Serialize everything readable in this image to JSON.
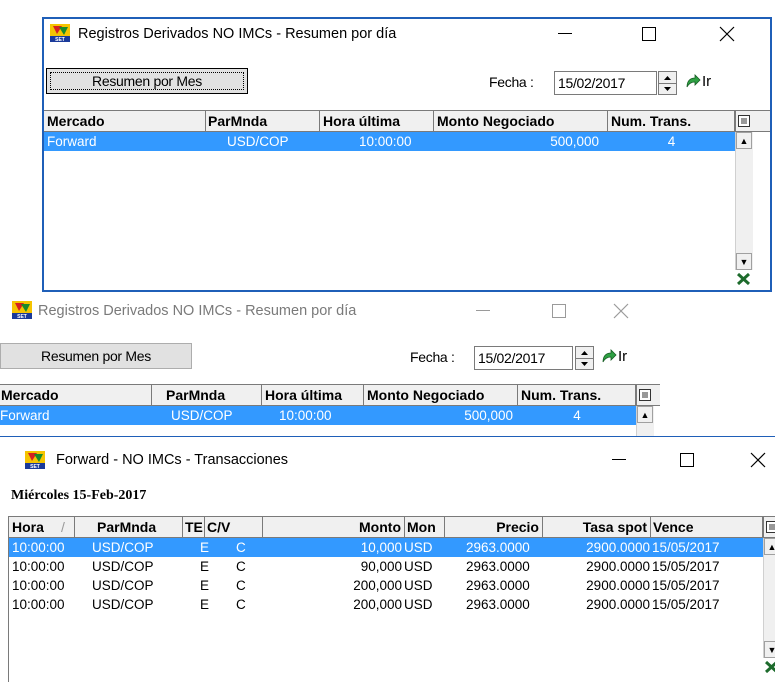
{
  "window1": {
    "title": "Registros Derivados NO IMCs - Resumen por día",
    "minimize": "—",
    "maximize": "☐",
    "close": "✕",
    "button_label": "Resumen por Mes",
    "fecha_label": "Fecha :",
    "fecha_value": "15/02/2017",
    "ir_label": "Ir",
    "columns": [
      "Mercado",
      "ParMnda",
      "Hora última",
      "Monto Negociado",
      "Num. Trans."
    ],
    "rows": [
      [
        "Forward",
        "USD/COP",
        "10:00:00",
        "500,000",
        "4"
      ]
    ]
  },
  "window2": {
    "title": "Registros Derivados NO IMCs - Resumen por día",
    "minimize": "—",
    "maximize": "☐",
    "close": "✕",
    "button_label": "Resumen por Mes",
    "fecha_label": "Fecha :",
    "fecha_value": "15/02/2017",
    "ir_label": "Ir",
    "columns": [
      "Mercado",
      "ParMnda",
      "Hora última",
      "Monto Negociado",
      "Num. Trans."
    ],
    "rows": [
      [
        "Forward",
        "USD/COP",
        "10:00:00",
        "500,000",
        "4"
      ]
    ]
  },
  "window3": {
    "title": "Forward - NO IMCs - Transacciones",
    "minimize": "—",
    "maximize": "☐",
    "close": "✕",
    "day_header": "Miércoles 15-Feb-2017",
    "columns": [
      "Hora",
      "ParMnda",
      "TE",
      "C/V",
      "Monto",
      "Mon",
      "Precio",
      "Tasa spot",
      "Vence"
    ],
    "rows": [
      [
        "10:00:00",
        "USD/COP",
        "E",
        "C",
        "10,000",
        "USD",
        "2963.0000",
        "2900.0000",
        "15/05/2017"
      ],
      [
        "10:00:00",
        "USD/COP",
        "E",
        "C",
        "90,000",
        "USD",
        "2963.0000",
        "2900.0000",
        "15/05/2017"
      ],
      [
        "10:00:00",
        "USD/COP",
        "E",
        "C",
        "200,000",
        "USD",
        "2963.0000",
        "2900.0000",
        "15/05/2017"
      ],
      [
        "10:00:00",
        "USD/COP",
        "E",
        "C",
        "200,000",
        "USD",
        "2963.0000",
        "2900.0000",
        "15/05/2017"
      ]
    ]
  },
  "icons": {
    "app": "set-logo-icon",
    "spinner": "up-down-spinner-icon",
    "go": "green-go-arrow-icon",
    "export": "excel-export-icon",
    "columns": "column-chooser-icon"
  },
  "colors": {
    "selection": "#3399ff",
    "window_border": "#1f5fb8"
  }
}
